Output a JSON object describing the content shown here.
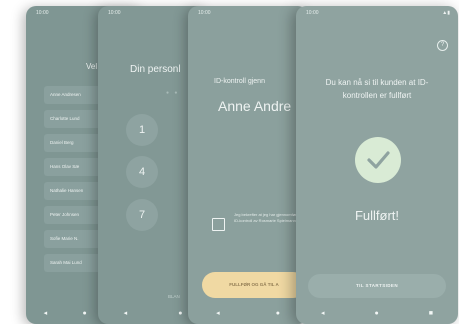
{
  "phone1": {
    "status_time": "10:00",
    "title": "Vel",
    "items": [
      "Anne Andresen",
      "Charlotte Lund",
      "Daniel Berg",
      "Hans Olav Sæ",
      "Nathalie Hansen",
      "Peter Johnsen",
      "Sofie Marie N.",
      "Sarah Mai Lund"
    ],
    "nav": [
      "◂",
      "●",
      "■"
    ]
  },
  "phone2": {
    "status_time": "10:00",
    "title": "Din personl",
    "dots": "● ●",
    "keys": [
      "1",
      "4",
      "7"
    ],
    "skip": "BLAN",
    "nav": [
      "◂",
      "●"
    ]
  },
  "phone3": {
    "status_time": "10:00",
    "subtitle": "ID-kontroll gjenn",
    "name": "Anne Andre",
    "consent": "Jeg bekrefter at jeg har gjennomført ID-kontroll av Rosmarie Spielmann",
    "cta": "FULLFØR OG GÅ TIL A",
    "nav": [
      "◂",
      "●"
    ]
  },
  "phone4": {
    "status_time": "10:00",
    "status_icons": "▲▮",
    "help": "?",
    "message": "Du kan nå si til kunden at ID-kontrollen er fullført",
    "done": "Fullført!",
    "cta": "TIL STARTSIDEN",
    "nav": [
      "◂",
      "●",
      "■"
    ],
    "accent": "#d9ebd5"
  }
}
